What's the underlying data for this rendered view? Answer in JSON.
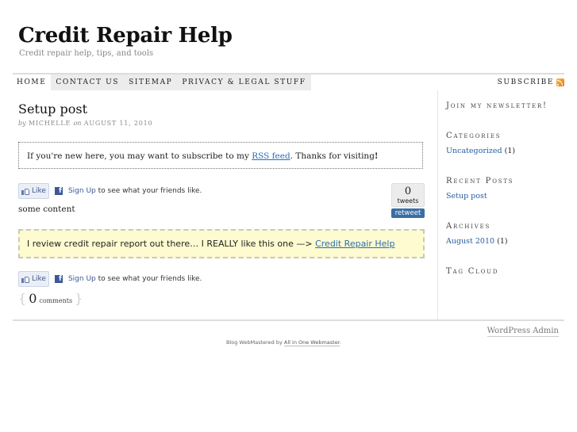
{
  "header": {
    "site_title": "Credit Repair Help",
    "tagline": "Credit repair help, tips, and tools"
  },
  "nav": {
    "items": [
      {
        "label": "HOME"
      },
      {
        "label": "CONTACT US"
      },
      {
        "label": "SITEMAP"
      },
      {
        "label": "PRIVACY & LEGAL STUFF"
      }
    ],
    "subscribe_label": "SUBSCRIBE",
    "subscribe_icon": "rss-icon"
  },
  "post": {
    "title": "Setup post",
    "meta_by": "by",
    "author": "MICHELLE",
    "meta_on": "on",
    "date": "AUGUST 11, 2010",
    "notice": {
      "before": "If you're new here, you may want to subscribe to my ",
      "link": "RSS feed",
      "after": ". Thanks for visiting",
      "bang": "!"
    },
    "facebook": {
      "like_label": "Like",
      "signup_label": "Sign Up",
      "signup_suffix": "to see what your friends like."
    },
    "tweet": {
      "count": "0",
      "count_label": "tweets",
      "retweet_label": "retweet"
    },
    "content": "some content",
    "promo": {
      "text": "I review credit repair report out there… I REALLY like this one —> ",
      "link": "Credit Repair Help",
      "background": "#fdfbcf"
    },
    "comments": {
      "open_brace": "{",
      "count": "0",
      "label": "comments",
      "close_brace": "}"
    }
  },
  "sidebar": {
    "newsletter_title": "Join my newsletter!",
    "categories": {
      "title": "Categories",
      "items": [
        {
          "label": "Uncategorized",
          "count": "(1)"
        }
      ]
    },
    "recent_posts": {
      "title": "Recent Posts",
      "items": [
        {
          "label": "Setup post"
        }
      ]
    },
    "archives": {
      "title": "Archives",
      "items": [
        {
          "label": "August 2010",
          "count": "(1)"
        }
      ]
    },
    "tag_cloud": {
      "title": "Tag Cloud"
    }
  },
  "footer": {
    "admin_link": "WordPress Admin",
    "credit_prefix": "Blog WebMastered by ",
    "credit_link": "All in One Webmaster",
    "credit_suffix": "."
  },
  "colors": {
    "link": "#2a6cb5",
    "facebook": "#3b5998",
    "retweet": "#3a6ea5"
  }
}
